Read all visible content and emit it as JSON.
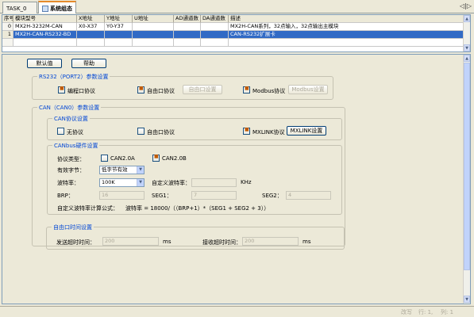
{
  "tabs": [
    {
      "label": "TASK_0",
      "active": false
    },
    {
      "label": "系统组态",
      "active": true
    }
  ],
  "nav": {
    "arrows": "◁|▷"
  },
  "grid": {
    "headers": [
      "序号",
      "模块型号",
      "X地址",
      "Y地址",
      "U地址",
      "AD通道数",
      "DA通道数",
      "描述"
    ],
    "rows": [
      [
        "0",
        "MX2H-3232M-CAN",
        "X0-X37",
        "Y0-Y37",
        "",
        "",
        "",
        "MX2H-CAN系列，32点输入，32点输出主模块"
      ],
      [
        "1",
        "MX2H-CAN-RS232-BD",
        "",
        "",
        "",
        "",
        "",
        "CAN-RS232扩展卡"
      ]
    ]
  },
  "buttons": {
    "default": "默认值",
    "help": "帮助"
  },
  "rs232": {
    "title": "RS232（PORT2）参数设置",
    "prog": "编程口协议",
    "free": "自由口协议",
    "free_set": "自由口设置",
    "modbus": "Modbus协议",
    "modbus_set": "Modbus设置"
  },
  "can": {
    "title": "CAN（CAN0）参数设置",
    "proto_title": "CAN协议设置",
    "none": "无协议",
    "free": "自由口协议",
    "mxlink": "MXLINK协议",
    "mxlink_set": "MXLINK设置",
    "hw_title": "CANbus硬件设置",
    "proto_type": "协议类型：",
    "can2a": "CAN2.0A",
    "can2b": "CAN2.0B",
    "valid_byte": "有效字节：",
    "valid_value": "低字节有效",
    "baud": "波特率：",
    "baud_value": "100K",
    "custom_baud": "自定义波特率：",
    "khz": "KHz",
    "brp": "BRP：",
    "brp_value": "16",
    "seg1": "SEG1：",
    "seg1_value": "7",
    "seg2": "SEG2：",
    "seg2_value": "4",
    "formula_label": "自定义波特率计算公式：",
    "formula": "波特率 = 18000/（（BRP+1）*（SEG1 + SEG2 + 3））"
  },
  "timeout": {
    "title": "自由口时间设置",
    "send": "发送超时时间：",
    "send_value": "200",
    "recv": "接收超时时间：",
    "recv_value": "200",
    "unit": "ms"
  },
  "status": {
    "mode": "改写",
    "row": "行: 1,",
    "col": "列: 1"
  }
}
